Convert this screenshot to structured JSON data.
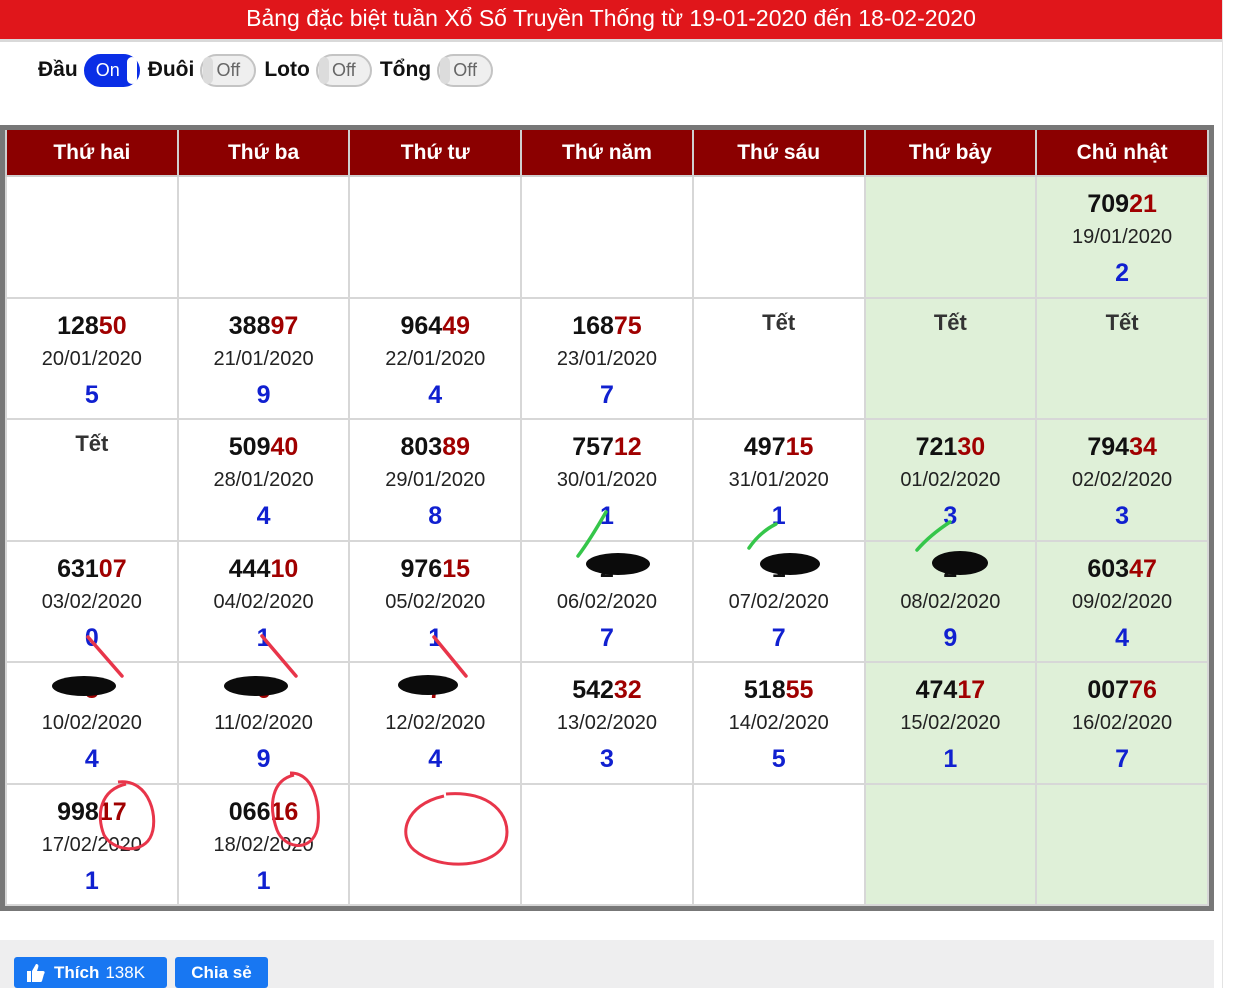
{
  "header": {
    "title": "Bảng đặc biệt tuần Xổ Số Truyền Thống từ 19-01-2020 đến 18-02-2020"
  },
  "toggles": [
    {
      "label": "Đầu",
      "state": "On"
    },
    {
      "label": "Đuôi",
      "state": "Off"
    },
    {
      "label": "Loto",
      "state": "Off"
    },
    {
      "label": "Tổng",
      "state": "Off"
    }
  ],
  "calendar": {
    "weekdays": [
      "Thứ hai",
      "Thứ ba",
      "Thứ tư",
      "Thứ năm",
      "Thứ sáu",
      "Thứ bảy",
      "Chủ nhật"
    ],
    "rows": [
      [
        {
          "empty": true
        },
        {
          "empty": true
        },
        {
          "empty": true
        },
        {
          "empty": true
        },
        {
          "empty": true
        },
        {
          "empty": true
        },
        {
          "head": "709",
          "tail": "21",
          "date": "19/01/2020",
          "sum": "2"
        }
      ],
      [
        {
          "head": "128",
          "tail": "50",
          "date": "20/01/2020",
          "sum": "5"
        },
        {
          "head": "388",
          "tail": "97",
          "date": "21/01/2020",
          "sum": "9"
        },
        {
          "head": "964",
          "tail": "49",
          "date": "22/01/2020",
          "sum": "4"
        },
        {
          "head": "168",
          "tail": "75",
          "date": "23/01/2020",
          "sum": "7"
        },
        {
          "note": "Tết"
        },
        {
          "note": "Tết"
        },
        {
          "note": "Tết"
        }
      ],
      [
        {
          "note": "Tết"
        },
        {
          "head": "509",
          "tail": "40",
          "date": "28/01/2020",
          "sum": "4"
        },
        {
          "head": "803",
          "tail": "89",
          "date": "29/01/2020",
          "sum": "8"
        },
        {
          "head": "757",
          "tail": "12",
          "date": "30/01/2020",
          "sum": "1"
        },
        {
          "head": "497",
          "tail": "15",
          "date": "31/01/2020",
          "sum": "1"
        },
        {
          "head": "721",
          "tail": "30",
          "date": "01/02/2020",
          "sum": "3"
        },
        {
          "head": "794",
          "tail": "34",
          "date": "02/02/2020",
          "sum": "3"
        }
      ],
      [
        {
          "head": "631",
          "tail": "07",
          "date": "03/02/2020",
          "sum": "0"
        },
        {
          "head": "444",
          "tail": "10",
          "date": "04/02/2020",
          "sum": "1"
        },
        {
          "head": "976",
          "tail": "15",
          "date": "05/02/2020",
          "sum": "1"
        },
        {
          "head": "2",
          "tail": "",
          "date": "06/02/2020",
          "sum": "7",
          "redacted": true
        },
        {
          "head": "1",
          "tail": "",
          "date": "07/02/2020",
          "sum": "7",
          "redacted": true
        },
        {
          "head": "2",
          "tail": "",
          "date": "08/02/2020",
          "sum": "9",
          "redacted": true
        },
        {
          "head": "603",
          "tail": "47",
          "date": "09/02/2020",
          "sum": "4"
        }
      ],
      [
        {
          "head": "",
          "tail": "5",
          "date": "10/02/2020",
          "sum": "4",
          "redacted": true
        },
        {
          "head": "",
          "tail": "6",
          "date": "11/02/2020",
          "sum": "9",
          "redacted": true
        },
        {
          "head": "",
          "tail": "7",
          "date": "12/02/2020",
          "sum": "4",
          "redacted": true
        },
        {
          "head": "542",
          "tail": "32",
          "date": "13/02/2020",
          "sum": "3"
        },
        {
          "head": "518",
          "tail": "55",
          "date": "14/02/2020",
          "sum": "5"
        },
        {
          "head": "474",
          "tail": "17",
          "date": "15/02/2020",
          "sum": "1"
        },
        {
          "head": "007",
          "tail": "76",
          "date": "16/02/2020",
          "sum": "7"
        }
      ],
      [
        {
          "head": "998",
          "tail": "17",
          "date": "17/02/2020",
          "sum": "1"
        },
        {
          "head": "066",
          "tail": "16",
          "date": "18/02/2020",
          "sum": "1"
        },
        {
          "empty": true
        },
        {
          "empty": true
        },
        {
          "empty": true
        },
        {
          "empty": true
        },
        {
          "empty": true
        }
      ]
    ]
  },
  "social": {
    "like_label": "Thích",
    "like_count": "138K",
    "share_label": "Chia sẻ"
  },
  "colors": {
    "title_bg": "#e0161b",
    "header_bg": "#8b0000",
    "tail_red": "#a00000",
    "sum_blue": "#1020d0",
    "weekend_bg": "#dff0d8",
    "toggle_on": "#0a2ee6"
  }
}
